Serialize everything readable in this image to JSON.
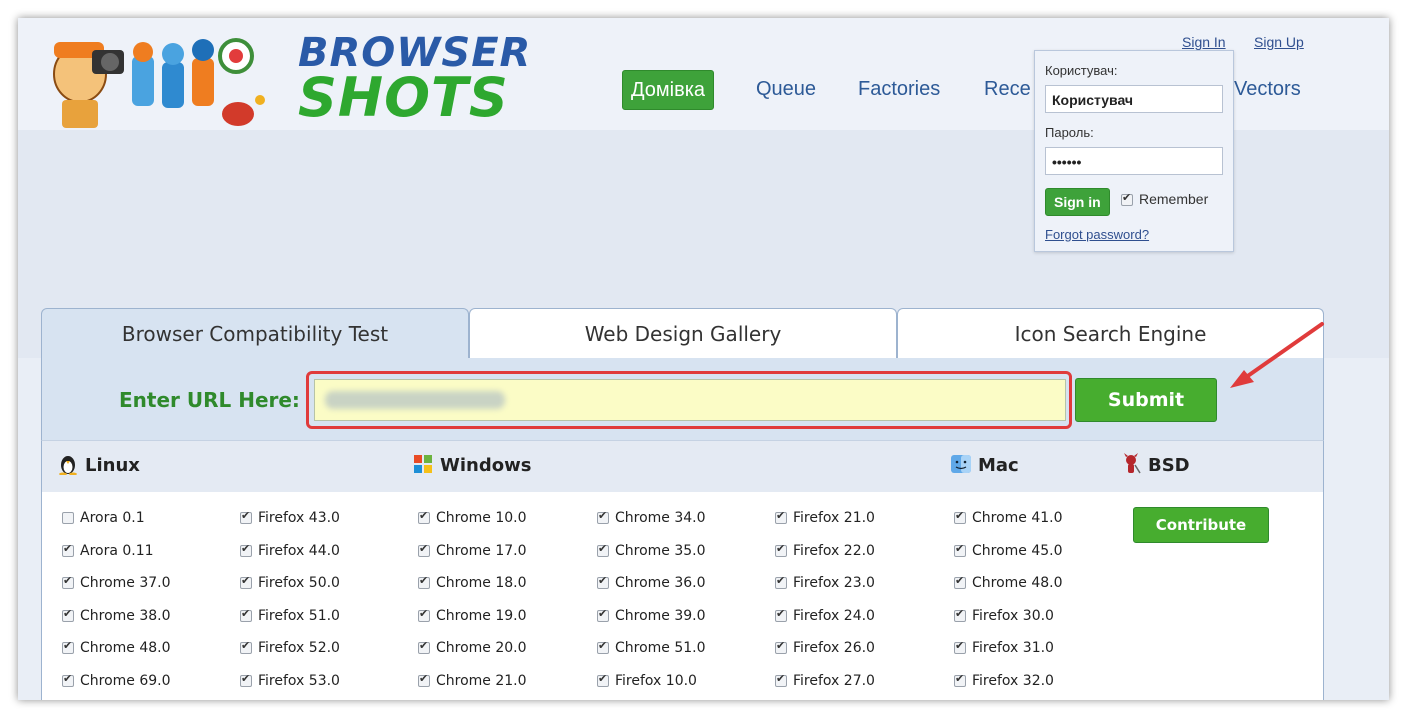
{
  "logo": {
    "line1": "BROWSER",
    "line2": "SHOTS"
  },
  "nav": {
    "home": "Домівка",
    "queue": "Queue",
    "factories": "Factories",
    "recent": "Rece",
    "vectors": "Vectors"
  },
  "auth": {
    "sign_in": "Sign In",
    "sign_up": "Sign Up"
  },
  "login": {
    "user_label": "Користувач:",
    "user_value": "Користувач",
    "password_label": "Пароль:",
    "password_value": "••••••",
    "signin_button": "Sign in",
    "remember_label": "Remember",
    "remember_checked": true,
    "forgot": "Forgot password?"
  },
  "tabs": [
    "Browser Compatibility Test",
    "Web Design Gallery",
    "Icon Search Engine"
  ],
  "url": {
    "label": "Enter URL Here:",
    "submit": "Submit"
  },
  "os": {
    "linux": "Linux",
    "windows": "Windows",
    "mac": "Mac",
    "bsd": "BSD"
  },
  "contribute": "Contribute",
  "browsers": [
    [
      {
        "label": "Arora 0.1",
        "checked": false
      },
      {
        "label": "Arora 0.11",
        "checked": true
      },
      {
        "label": "Chrome 37.0",
        "checked": true
      },
      {
        "label": "Chrome 38.0",
        "checked": true
      },
      {
        "label": "Chrome 48.0",
        "checked": true
      },
      {
        "label": "Chrome 69.0",
        "checked": true
      }
    ],
    [
      {
        "label": "Firefox 43.0",
        "checked": true
      },
      {
        "label": "Firefox 44.0",
        "checked": true
      },
      {
        "label": "Firefox 50.0",
        "checked": true
      },
      {
        "label": "Firefox 51.0",
        "checked": true
      },
      {
        "label": "Firefox 52.0",
        "checked": true
      },
      {
        "label": "Firefox 53.0",
        "checked": true
      }
    ],
    [
      {
        "label": "Chrome 10.0",
        "checked": true
      },
      {
        "label": "Chrome 17.0",
        "checked": true
      },
      {
        "label": "Chrome 18.0",
        "checked": true
      },
      {
        "label": "Chrome 19.0",
        "checked": true
      },
      {
        "label": "Chrome 20.0",
        "checked": true
      },
      {
        "label": "Chrome 21.0",
        "checked": true
      }
    ],
    [
      {
        "label": "Chrome 34.0",
        "checked": true
      },
      {
        "label": "Chrome 35.0",
        "checked": true
      },
      {
        "label": "Chrome 36.0",
        "checked": true
      },
      {
        "label": "Chrome 39.0",
        "checked": true
      },
      {
        "label": "Chrome 51.0",
        "checked": true
      },
      {
        "label": "Firefox 10.0",
        "checked": true
      }
    ],
    [
      {
        "label": "Firefox 21.0",
        "checked": true
      },
      {
        "label": "Firefox 22.0",
        "checked": true
      },
      {
        "label": "Firefox 23.0",
        "checked": true
      },
      {
        "label": "Firefox 24.0",
        "checked": true
      },
      {
        "label": "Firefox 26.0",
        "checked": true
      },
      {
        "label": "Firefox 27.0",
        "checked": true
      }
    ],
    [
      {
        "label": "Chrome 41.0",
        "checked": true
      },
      {
        "label": "Chrome 45.0",
        "checked": true
      },
      {
        "label": "Chrome 48.0",
        "checked": true
      },
      {
        "label": "Firefox 30.0",
        "checked": true
      },
      {
        "label": "Firefox 31.0",
        "checked": true
      },
      {
        "label": "Firefox 32.0",
        "checked": true
      }
    ]
  ],
  "colors": {
    "accent_green": "#3ea23a",
    "link_blue": "#2d5a97",
    "highlight_red": "#e03b3b",
    "url_field": "#fbfcc6"
  }
}
